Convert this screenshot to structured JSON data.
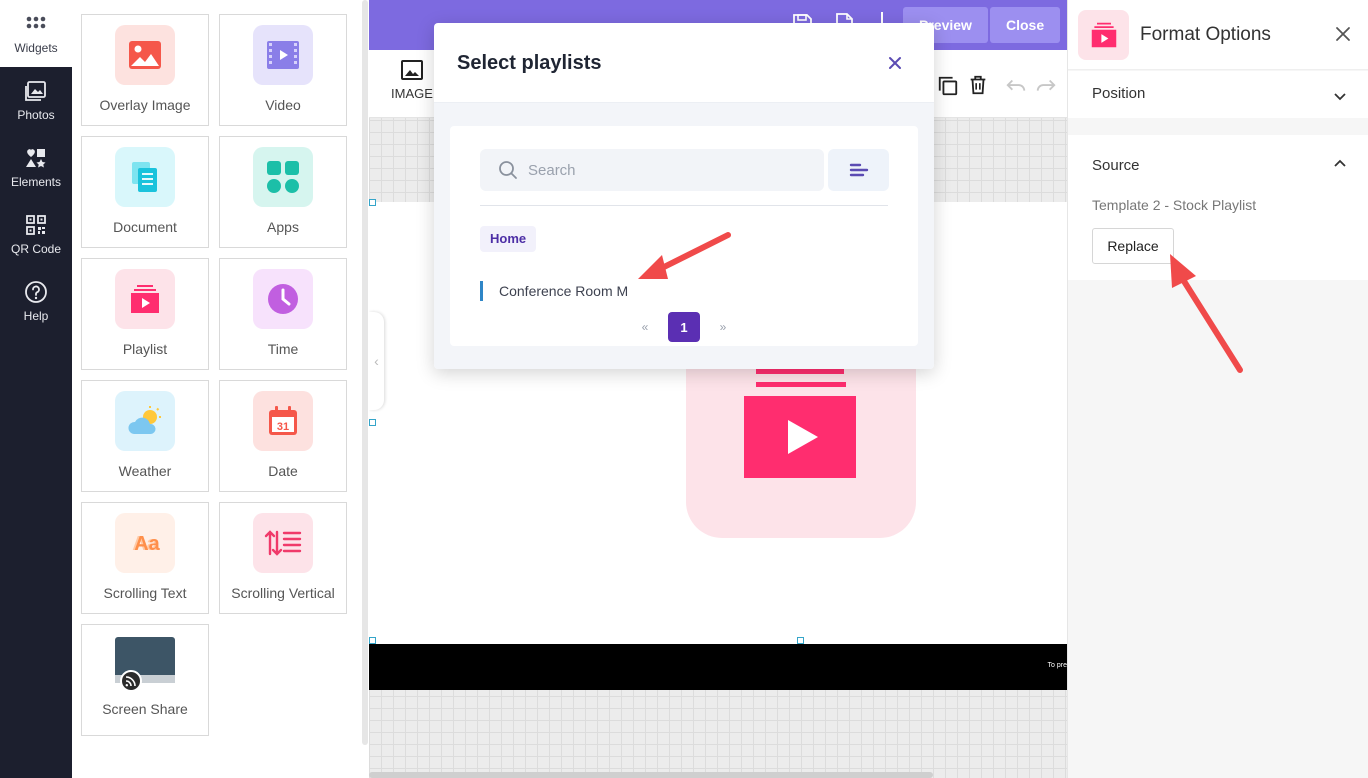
{
  "nav": {
    "items": [
      {
        "label": "Widgets",
        "icon": "grid-icon",
        "active": true
      },
      {
        "label": "Photos",
        "icon": "photos-icon"
      },
      {
        "label": "Elements",
        "icon": "elements-icon"
      },
      {
        "label": "QR Code",
        "icon": "qr-code-icon"
      },
      {
        "label": "Help",
        "icon": "help-icon"
      }
    ]
  },
  "widgets": {
    "tiles": [
      {
        "label": "Overlay Image",
        "icon": "overlay-image-icon"
      },
      {
        "label": "Video",
        "icon": "video-icon"
      },
      {
        "label": "Document",
        "icon": "document-icon"
      },
      {
        "label": "Apps",
        "icon": "apps-icon"
      },
      {
        "label": "Playlist",
        "icon": "playlist-icon"
      },
      {
        "label": "Time",
        "icon": "clock-icon"
      },
      {
        "label": "Weather",
        "icon": "weather-icon"
      },
      {
        "label": "Date",
        "icon": "calendar-icon"
      },
      {
        "label": "Scrolling Text",
        "icon": "scrolling-text-icon"
      },
      {
        "label": "Scrolling Vertical",
        "icon": "scrolling-vertical-icon"
      },
      {
        "label": "Screen Share",
        "icon": "screen-share-icon"
      }
    ]
  },
  "editor": {
    "top_buttons": {
      "preview": "Preview",
      "close": "Close"
    },
    "image_tool_label": "IMAGE",
    "colors": {
      "topbar": "#7d6ae0",
      "canvas_footer": "#000000"
    }
  },
  "modal": {
    "title": "Select playlists",
    "search_placeholder": "Search",
    "breadcrumb": "Home",
    "items": [
      "Conference Room M"
    ],
    "pagination": {
      "prev": "«",
      "current": "1",
      "next": "»"
    }
  },
  "format_panel": {
    "title": "Format Options",
    "position_label": "Position",
    "source_label": "Source",
    "source_value": "Template 2 - Stock Playlist",
    "replace_label": "Replace"
  },
  "annotation_colors": {
    "arrow": "#f04a4a",
    "accent": "#5b2fb3",
    "playlist_pink": "#ff2d6f"
  }
}
